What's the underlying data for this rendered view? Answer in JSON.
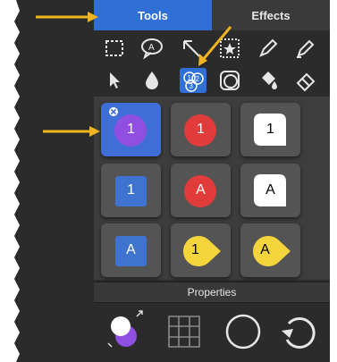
{
  "tabs": {
    "tools": "Tools",
    "effects": "Effects"
  },
  "toolbar_row1": [
    "selection-rect",
    "speech-bubble-A",
    "arrow",
    "stamp-star",
    "pen",
    "highlighter"
  ],
  "toolbar_row2": [
    "pointer",
    "drop",
    "counter-badge",
    "shape-outline",
    "fill-bucket",
    "eraser"
  ],
  "selected_tool": "counter-badge",
  "styles": [
    {
      "label": "1",
      "shape": "circle",
      "color": "#8f4fe0",
      "text_color": "#ffffff",
      "selected": true
    },
    {
      "label": "1",
      "shape": "circle",
      "color": "#e23b3b",
      "text_color": "#ffffff"
    },
    {
      "label": "1",
      "shape": "teardrop",
      "color": "#ffffff",
      "text_color": "#000000"
    },
    {
      "label": "1",
      "shape": "square",
      "color": "#3e73cf",
      "text_color": "#ffffff"
    },
    {
      "label": "A",
      "shape": "circle",
      "color": "#e23b3b",
      "text_color": "#ffffff"
    },
    {
      "label": "A",
      "shape": "teardrop",
      "color": "#ffffff",
      "text_color": "#000000"
    },
    {
      "label": "A",
      "shape": "square",
      "color": "#3e73cf",
      "text_color": "#ffffff"
    },
    {
      "label": "1",
      "shape": "pointer",
      "color": "#f4d63c",
      "text_color": "#000000"
    },
    {
      "label": "A",
      "shape": "pointer",
      "color": "#f4d63c",
      "text_color": "#000000"
    }
  ],
  "properties_label": "Properties",
  "properties_tools": [
    "color-swatch",
    "grid",
    "circle-outline",
    "undo"
  ],
  "colors": {
    "accent": "#2f6fd6",
    "arrow": "#f0b322"
  }
}
